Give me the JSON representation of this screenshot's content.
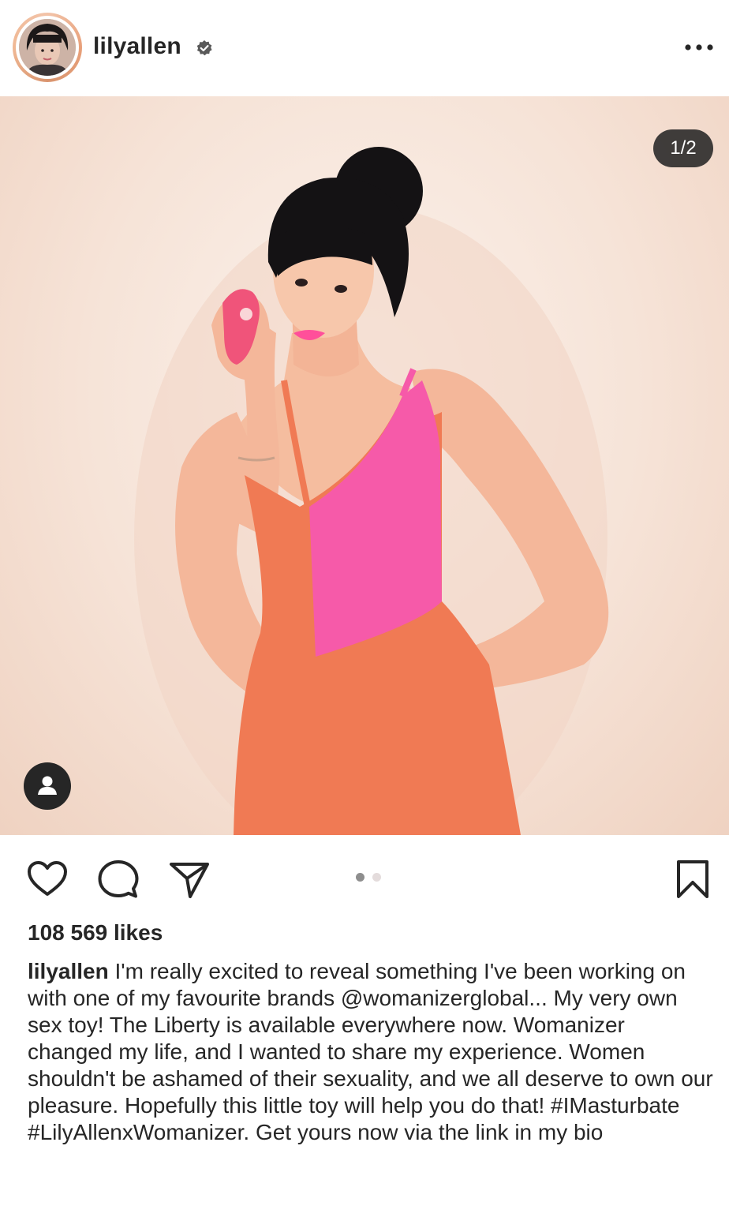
{
  "post": {
    "username": "lilyallen",
    "verified": true,
    "carousel_counter": "1/2",
    "carousel_index": 1,
    "carousel_total": 2,
    "likes": "108 569 likes",
    "caption_username": "lilyallen",
    "caption_text": "I'm really excited to reveal something I've been working on with one of my favourite brands @womanizerglobal... My very own sex toy! The Liberty is available everywhere now. Womanizer changed my life, and I wanted to share my experience. Women shouldn't be ashamed of their sexuality, and we all deserve to own our pleasure. Hopefully this little toy will help you do that! #IMasturbate #LilyAllenxWomanizer. Get yours now via the link in my bio"
  },
  "icons": {
    "verified": "verified-badge-icon",
    "more": "more-options-icon",
    "like": "heart-icon",
    "comment": "comment-icon",
    "share": "send-icon",
    "save": "bookmark-icon",
    "tags": "user-tag-icon"
  },
  "colors": {
    "text": "#262626",
    "dress_orange": "#f07a54",
    "dress_pink": "#f65aa9",
    "lipstick": "#ff4f9a",
    "dot_active": "#8e8e8e",
    "dot_inactive": "#e4dcdc"
  }
}
